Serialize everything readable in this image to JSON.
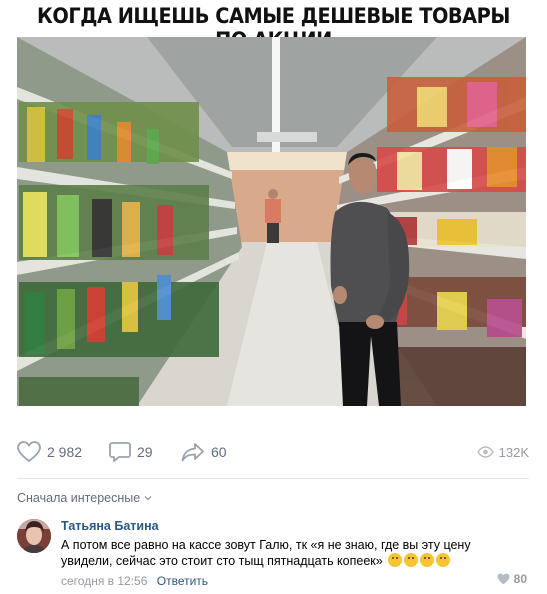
{
  "post": {
    "meme_caption": "КОГДА ИЩЕШЬ САМЫЕ ДЕШЕВЫЕ ТОВАРЫ ПО АКЦИИ"
  },
  "actions": {
    "likes": "2 982",
    "comments": "29",
    "shares": "60",
    "views": "132K"
  },
  "comments_section": {
    "sort_label": "Сначала интересные",
    "comment": {
      "author": "Татьяна Батина",
      "text": "А потом все равно на кассе зовут Галю, тк «я не знаю, где вы эту цену увидели, сейчас это стоит сто тыщ пятнадцать копеек»",
      "emoji": [
        "slightly-smiling-face",
        "neutral-face",
        "confused-face",
        "grinning-face"
      ],
      "time": "сегодня в 12:56",
      "reply_label": "Ответить",
      "likes": "80"
    }
  },
  "colors": {
    "link": "#2a5885",
    "muted": "#939ba4",
    "action": "#626d7a",
    "icon": "#99a2ad"
  }
}
